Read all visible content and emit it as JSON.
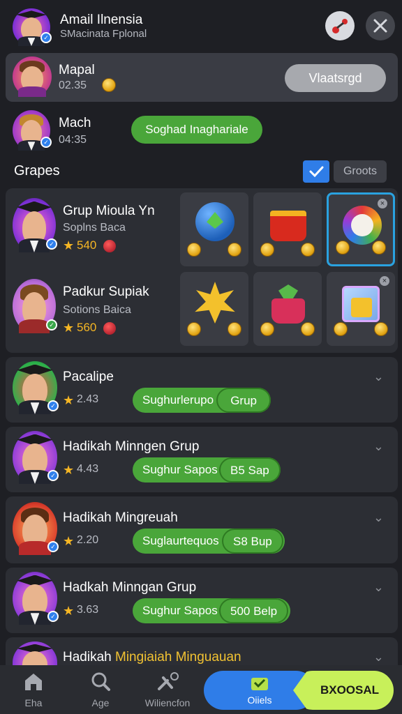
{
  "header": {
    "title": "Amail Ilnensia",
    "subtitle": "SMacinata Fplonal"
  },
  "current_user": {
    "name": "Mapal",
    "value": "02.35",
    "button_label": "Vlaatsrgd"
  },
  "second_user": {
    "name": "Mach",
    "value": "04:35",
    "button_label": "Soghad Inaghariale"
  },
  "section": {
    "title": "Grapes",
    "checkbox_checked": true,
    "button_label": "Groots"
  },
  "featured_groups": [
    {
      "name": "Grup Mioula Yn",
      "subtitle": "Soplns Baca",
      "rating": "540"
    },
    {
      "name": "Padkur Supiak",
      "subtitle": "Sotions Baica",
      "rating": "560"
    }
  ],
  "list": [
    {
      "name": "Pacalipe",
      "rating": "2.43",
      "action_label": "Sughurlerupo",
      "tag_label": "Grup"
    },
    {
      "name": "Hadikah Minngen Grup",
      "rating": "4.43",
      "action_label": "Sughur Sapos",
      "tag_label": "B5 Sap"
    },
    {
      "name": "Hadikah Mingreuah",
      "rating": "2.20",
      "action_label": "Suglaurtequos",
      "tag_label": "S8 Bup"
    },
    {
      "name": "Hadkah Minngan Grup",
      "rating": "3.63",
      "action_label": "Sughur Sapos",
      "tag_label": "500 Belp"
    },
    {
      "name_prefix": "Hadikah ",
      "name_highlight": "Mingiaiah Minguauan"
    }
  ],
  "bottom_nav": {
    "items": [
      "Eha",
      "Age",
      "Wiliencfon"
    ],
    "active_label": "Oiiels",
    "cta_label": "BXOOSAL"
  },
  "colors": {
    "background": "#1e1f24",
    "accent_green": "#4aa63a",
    "accent_blue": "#2f7de8",
    "cta_lime": "#c8f05a",
    "highlight_yellow": "#f1c232"
  }
}
